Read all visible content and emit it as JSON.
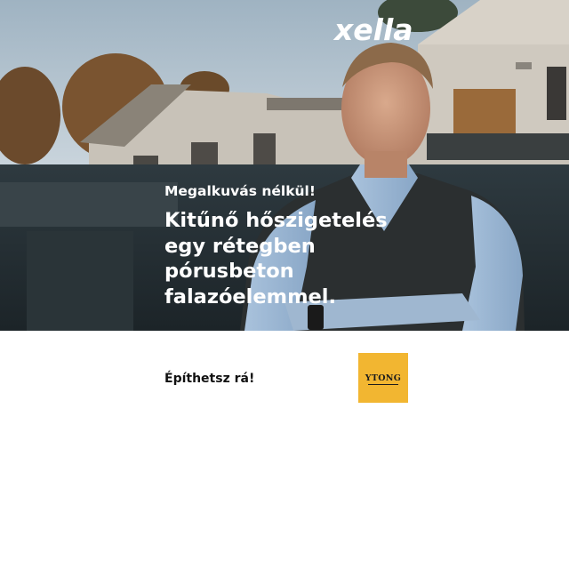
{
  "brand": {
    "name": "xella"
  },
  "hero": {
    "tagline": "Megalkuvás nélkül!",
    "headline": [
      "Kitűnő hőszigetelés",
      "egy rétegben",
      "pórusbeton",
      "falazóelemmel."
    ]
  },
  "footer": {
    "slogan": "Építhetsz rá!",
    "logo_text": "YTONG"
  },
  "colors": {
    "logo_background": "#f2b631",
    "text_light": "#ffffff",
    "text_dark": "#111111"
  }
}
